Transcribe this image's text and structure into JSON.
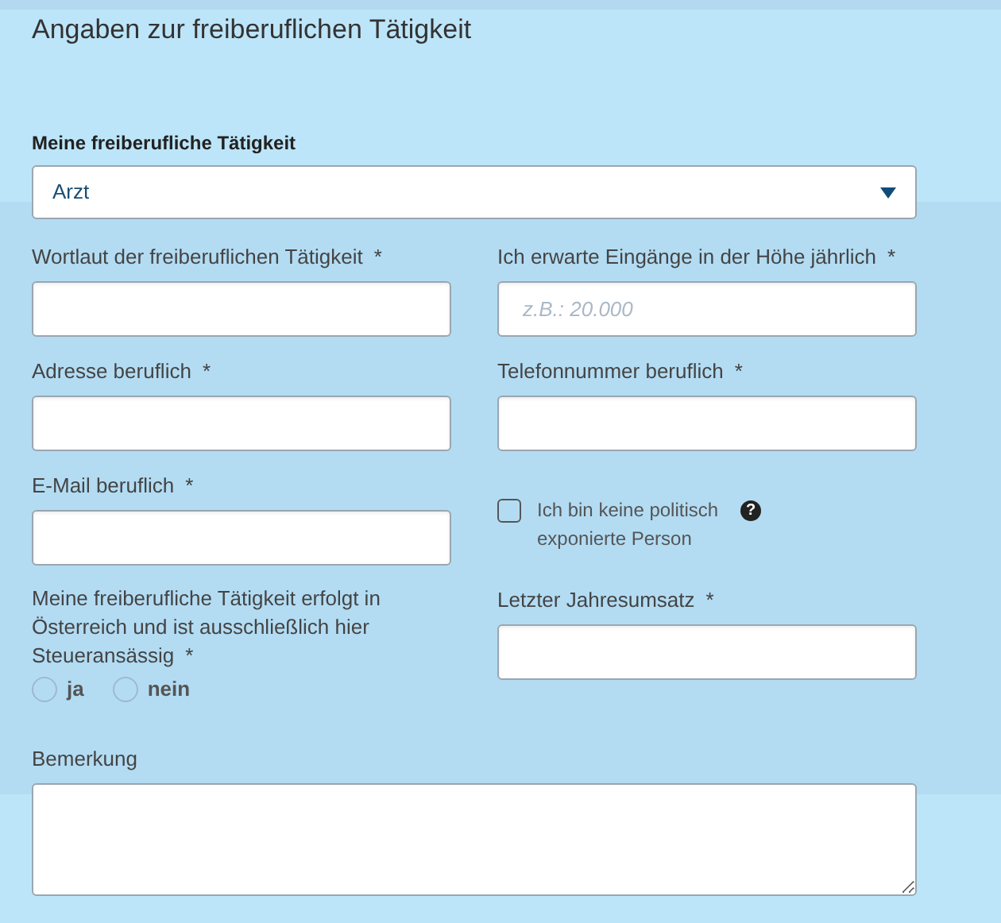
{
  "title": "Angaben zur freiberuflichen Tätigkeit",
  "select": {
    "label": "Meine freiberufliche Tätigkeit",
    "value": "Arzt"
  },
  "rows": [
    {
      "left": {
        "kind": "input",
        "label": "Wortlaut der freiberuflichen Tätigkeit",
        "marker": "*"
      },
      "right": {
        "kind": "input",
        "label": "Ich erwarte Eingänge in der Höhe jährlich",
        "marker": "*",
        "placeholder": "z.B.: 20.000"
      }
    },
    {
      "left": {
        "kind": "input",
        "label": "Adresse beruflich",
        "marker": "*"
      },
      "right": {
        "kind": "input",
        "label": "Telefonnummer beruflich",
        "marker": "*"
      }
    },
    {
      "left": {
        "kind": "input",
        "label": "E-Mail beruflich",
        "marker": "*"
      },
      "right": {
        "kind": "checkbox",
        "label": "Ich bin keine politisch exponierte Person",
        "checked": false,
        "help": "?"
      }
    },
    {
      "left": {
        "kind": "radio",
        "label": "Meine freiberufliche Tätigkeit erfolgt in Österreich und ist ausschließlich hier Steueransässig",
        "marker": "*",
        "options": [
          {
            "label": "ja",
            "selected": false
          },
          {
            "label": "nein",
            "selected": false
          }
        ]
      },
      "right": {
        "kind": "input",
        "label": "Letzter Jahresumsatz",
        "marker": "*"
      }
    }
  ],
  "remark": {
    "label": "Bemerkung"
  }
}
